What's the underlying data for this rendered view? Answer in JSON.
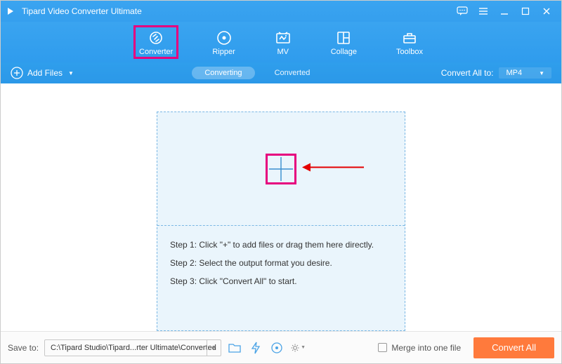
{
  "app": {
    "title": "Tipard Video Converter Ultimate"
  },
  "nav": {
    "items": [
      {
        "label": "Converter",
        "active": true
      },
      {
        "label": "Ripper",
        "active": false
      },
      {
        "label": "MV",
        "active": false
      },
      {
        "label": "Collage",
        "active": false
      },
      {
        "label": "Toolbox",
        "active": false
      }
    ]
  },
  "toolbar": {
    "add_files": "Add Files",
    "tabs": {
      "converting": "Converting",
      "converted": "Converted"
    },
    "convert_all_to_label": "Convert All to:",
    "convert_all_to_value": "MP4"
  },
  "drop": {
    "step1": "Step 1: Click \"+\" to add files or drag them here directly.",
    "step2": "Step 2: Select the output format you desire.",
    "step3": "Step 3: Click \"Convert All\" to start."
  },
  "bottom": {
    "save_to_label": "Save to:",
    "path": "C:\\Tipard Studio\\Tipard...rter Ultimate\\Converted",
    "merge_label": "Merge into one file",
    "merge_checked": false,
    "convert_all": "Convert All"
  }
}
